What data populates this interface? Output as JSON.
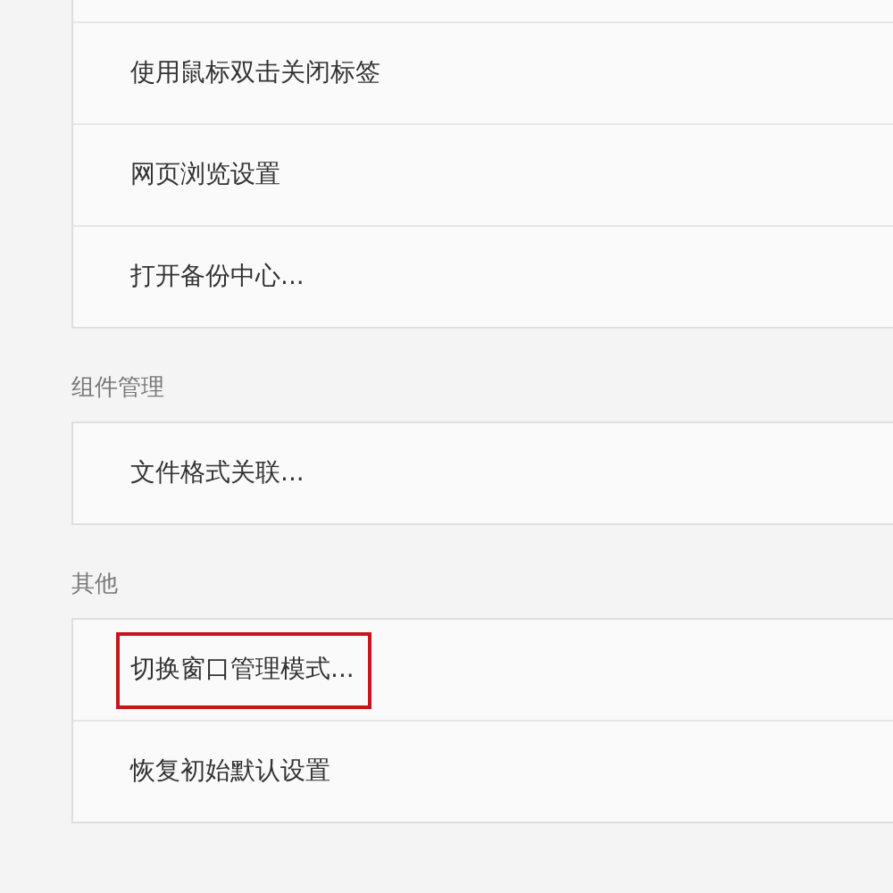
{
  "sections": [
    {
      "items": [
        {
          "label": "使用鼠标双击关闭标签",
          "highlighted": false
        },
        {
          "label": "网页浏览设置",
          "highlighted": false
        },
        {
          "label": "打开备份中心...",
          "highlighted": false
        }
      ]
    },
    {
      "title": "组件管理",
      "items": [
        {
          "label": "文件格式关联...",
          "highlighted": false
        }
      ]
    },
    {
      "title": "其他",
      "items": [
        {
          "label": "切换窗口管理模式...",
          "highlighted": true
        },
        {
          "label": "恢复初始默认设置",
          "highlighted": false
        }
      ]
    }
  ]
}
